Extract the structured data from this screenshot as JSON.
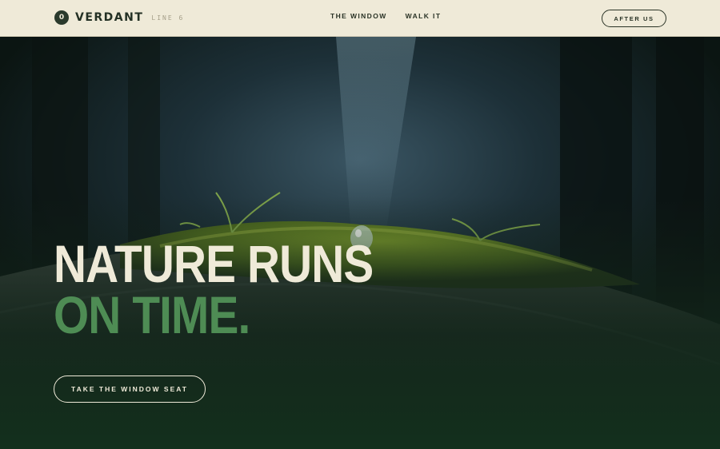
{
  "nav": {
    "logo_letter": "0",
    "brand": "VERDANT",
    "subtitle": "LINE 6",
    "links": [
      {
        "label": "THE WINDOW"
      },
      {
        "label": "WALK IT"
      }
    ],
    "cta_label": "AFTER US"
  },
  "hero": {
    "headline_line1": "NATURE RUNS",
    "headline_line2": "ON TIME.",
    "cta_label": "TAKE THE WINDOW SEAT",
    "image_subject": "moss-covered stone bridge with ferns and a water droplet in a misty dark forest"
  },
  "colors": {
    "nav_bg": "#efead8",
    "ink": "#2a3326",
    "accent_green": "#4e8c54",
    "cream_text": "#efead8",
    "forest_dark": "#0f1b14"
  }
}
